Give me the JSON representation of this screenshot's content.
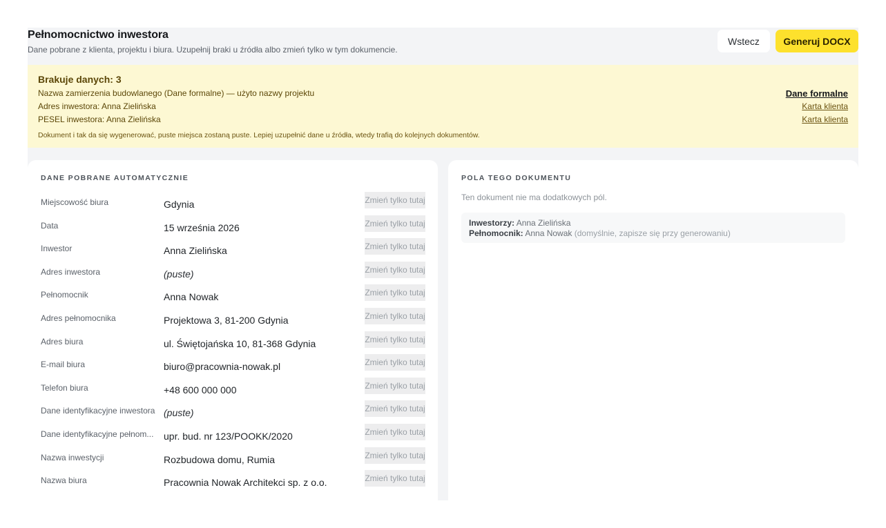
{
  "header": {
    "title": "Pełnomocnictwo inwestora",
    "subtitle": "Dane pobrane z klienta, projektu i biura. Uzupełnij braki u źródła albo zmień tylko w tym dokumencie.",
    "back_label": "Wstecz",
    "generate_label": "Generuj DOCX"
  },
  "alert": {
    "title": "Brakuje danych: 3",
    "items": [
      {
        "text": "Nazwa zamierzenia budowlanego (Dane formalne) — użyto nazwy projektu",
        "link": "Dane formalne"
      },
      {
        "text": "Adres inwestora: Anna Zielińska",
        "link": "Karta klienta"
      },
      {
        "text": "PESEL inwestora: Anna Zielińska",
        "link": "Karta klienta"
      }
    ],
    "note": "Dokument i tak da się wygenerować, puste miejsca zostaną puste. Lepiej uzupełnić dane u źródła, wtedy trafią do kolejnych dokumentów."
  },
  "auto_data": {
    "heading": "Dane pobrane automatycznie",
    "change_label": "Zmień tylko tutaj",
    "rows": [
      {
        "label": "Miejscowość biura",
        "value": "Gdynia"
      },
      {
        "label": "Data",
        "value": "15 września 2026"
      },
      {
        "label": "Inwestor",
        "value": "Anna Zielińska"
      },
      {
        "label": "Adres inwestora",
        "value": "(puste)"
      },
      {
        "label": "Pełnomocnik",
        "value": "Anna Nowak"
      },
      {
        "label": "Adres pełnomocnika",
        "value": "Projektowa 3, 81-200 Gdynia"
      },
      {
        "label": "Adres biura",
        "value": "ul. Świętojańska 10, 81-368 Gdynia"
      },
      {
        "label": "E-mail biura",
        "value": "biuro@pracownia-nowak.pl"
      },
      {
        "label": "Telefon biura",
        "value": "+48 600 000 000"
      },
      {
        "label": "Dane identyfikacyjne inwestora",
        "value": "(puste)"
      },
      {
        "label": "Dane identyfikacyjne pełnom...",
        "value": "upr. bud. nr 123/POOKK/2020"
      },
      {
        "label": "Nazwa inwestycji",
        "value": "Rozbudowa domu, Rumia"
      },
      {
        "label": "Nazwa biura",
        "value": "Pracownia Nowak Architekci sp. z o.o."
      }
    ]
  },
  "doc_fields": {
    "heading": "Pola tego dokumentu",
    "empty_text": "Ten dokument nie ma dodatkowych pól.",
    "investors_label": "Inwestorzy:",
    "investors_value": "Anna Zielińska",
    "attorney_label": "Pełnomocnik:",
    "attorney_value": "Anna Nowak",
    "attorney_note": "(domyślnie, zapisze się przy generowaniu)"
  }
}
